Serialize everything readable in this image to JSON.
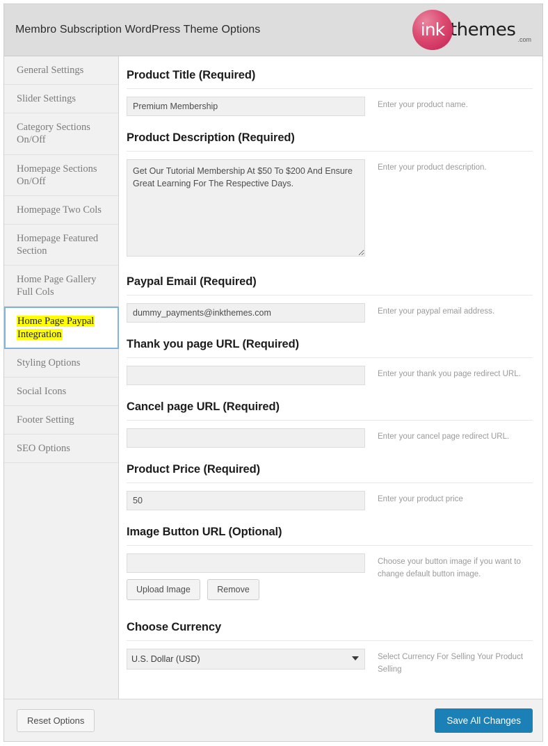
{
  "header": {
    "title": "Membro Subscription WordPress Theme Options",
    "logo": {
      "mark_text": "ink",
      "word": "themes",
      "tld": ".com",
      "circle_color": "#d8476c"
    }
  },
  "sidebar": {
    "items": [
      {
        "label": "General Settings",
        "active": false
      },
      {
        "label": "Slider Settings",
        "active": false
      },
      {
        "label": "Category Sections On/Off",
        "active": false
      },
      {
        "label": "Homepage Sections On/Off",
        "active": false
      },
      {
        "label": "Homepage Two Cols",
        "active": false
      },
      {
        "label": "Homepage Featured Section",
        "active": false
      },
      {
        "label": "Home Page Gallery Full Cols",
        "active": false
      },
      {
        "label": "Home Page Paypal Integration",
        "active": true
      },
      {
        "label": "Styling Options",
        "active": false
      },
      {
        "label": "Social Icons",
        "active": false
      },
      {
        "label": "Footer Setting",
        "active": false
      },
      {
        "label": "SEO Options",
        "active": false
      }
    ],
    "highlight_color": "#ffff00",
    "active_border_color": "#7fb4de"
  },
  "main": {
    "sections": {
      "product_title": {
        "heading": "Product Title (Required)",
        "value": "Premium Membership",
        "placeholder": "",
        "desc": "Enter your product name."
      },
      "product_description": {
        "heading": "Product Description (Required)",
        "value": "Get Our Tutorial Membership At $50 To $200 And Ensure Great Learning For The Respective Days.",
        "placeholder": "",
        "desc": "Enter your product description."
      },
      "paypal_email": {
        "heading": "Paypal Email (Required)",
        "value": "dummy_payments@inkthemes.com",
        "placeholder": "",
        "desc": "Enter your paypal email address."
      },
      "thank_you_url": {
        "heading": "Thank you page URL (Required)",
        "value": "",
        "placeholder": "",
        "desc": "Enter your thank you page redirect URL."
      },
      "cancel_url": {
        "heading": "Cancel page URL (Required)",
        "value": "",
        "placeholder": "",
        "desc": "Enter your cancel page redirect URL."
      },
      "product_price": {
        "heading": "Product Price (Required)",
        "value": "50",
        "placeholder": "",
        "desc": "Enter your product price"
      },
      "image_button_url": {
        "heading": "Image Button URL (Optional)",
        "value": "",
        "placeholder": "",
        "desc": "Choose your button image if you want to change default button image.",
        "upload_label": "Upload Image",
        "remove_label": "Remove"
      },
      "choose_currency": {
        "heading": "Choose Currency",
        "selected": "U.S. Dollar (USD)",
        "desc": "Select Currency For Selling Your Product Selling",
        "options": [
          "U.S. Dollar (USD)"
        ]
      }
    }
  },
  "footer": {
    "reset_label": "Reset Options",
    "save_label": "Save All Changes",
    "save_color": "#1a80b6"
  }
}
